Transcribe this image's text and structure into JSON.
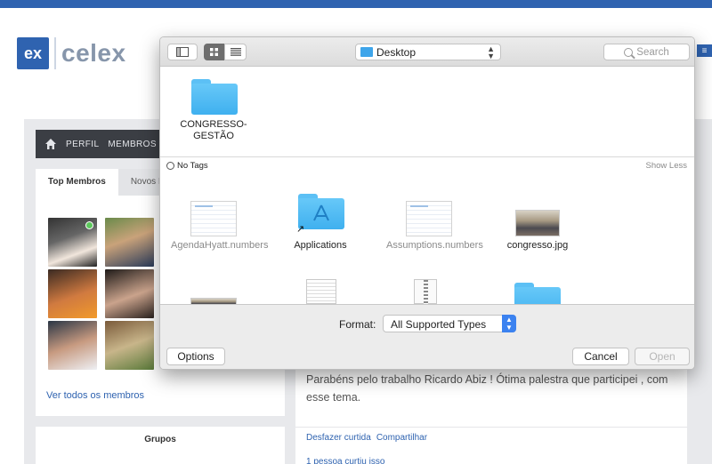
{
  "website": {
    "logo_mark": "ex",
    "logo_text": "celex",
    "nav": [
      "PERFIL",
      "MEMBROS"
    ],
    "tabs": {
      "active": "Top Membros",
      "inactive": "Novos M"
    },
    "see_all_members": "Ver todos os membros",
    "groups_title": "Grupos",
    "post": {
      "text": "Parabéns pelo trabalho Ricardo Abiz ! Ótima palestra que participei , com esse tema.",
      "action_undo_like": "Desfazer curtida",
      "action_share": "Compartilhar",
      "likes": "1 pessoa curtiu isso"
    },
    "colors": {
      "brand": "#2f63b0",
      "navbar": "#3b3e44",
      "background": "#e8e9ec"
    }
  },
  "dialog": {
    "location": "Desktop",
    "search_placeholder": "Search",
    "pinned_folder_label": "CONGRESSO-GESTÃO",
    "tags_label": "No Tags",
    "show_less": "Show Less",
    "files": [
      {
        "label": "AgendaHyatt.numbers",
        "icon": "numbers-spreadsheet-icon",
        "dimmed": true
      },
      {
        "label": "Applications",
        "icon": "applications-folder-icon",
        "dimmed": false
      },
      {
        "label": "Assumptions.numbers",
        "icon": "numbers-spreadsheet-icon",
        "dimmed": true
      },
      {
        "label": "congresso.jpg",
        "icon": "photo-icon",
        "dimmed": false
      }
    ],
    "format_label": "Format:",
    "format_value": "All Supported Types",
    "buttons": {
      "options": "Options",
      "cancel": "Cancel",
      "open": "Open"
    },
    "colors": {
      "folder": "#3fb0ef",
      "select_accent": "#3b82f0"
    }
  }
}
